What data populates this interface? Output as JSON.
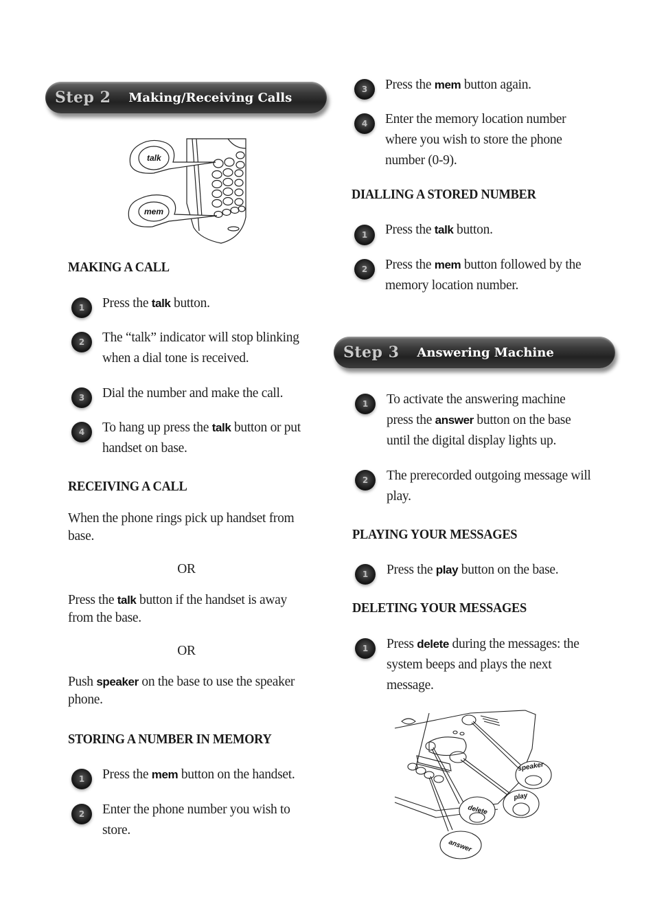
{
  "step2": {
    "banner": {
      "step_label": "Step 2",
      "title": "Making/Receiving Calls"
    },
    "illustration": {
      "callouts": [
        "talk",
        "mem"
      ]
    },
    "making_a_call": {
      "heading": "MAKING A CALL",
      "steps": [
        {
          "num": "1",
          "pre": "Press the ",
          "kw": "talk",
          "post": " button."
        },
        {
          "num": "2",
          "text": "The “talk” indicator will stop blinking when a dial tone is received."
        },
        {
          "num": "3",
          "text": "Dial the number and make the call."
        },
        {
          "num": "4",
          "pre": "To hang up press the ",
          "kw": "talk",
          "post": " button or put handset on base."
        }
      ]
    },
    "receiving_a_call": {
      "heading": "RECEIVING A CALL",
      "para1": "When the phone rings pick up handset from base.",
      "or1": "OR",
      "para2": {
        "pre": "Press the ",
        "kw": "talk",
        "post": " button if the handset is away from the base."
      },
      "or2": "OR",
      "para3": {
        "pre": "Push ",
        "kw": "speaker",
        "post": " on the base to use the speaker phone."
      }
    },
    "storing": {
      "heading": "STORING A NUMBER IN MEMORY",
      "steps": [
        {
          "num": "1",
          "pre": "Press the ",
          "kw": "mem",
          "post": " button on the handset."
        },
        {
          "num": "2",
          "text": "Enter the phone number you wish to store."
        },
        {
          "num": "3",
          "pre": "Press the ",
          "kw": "mem",
          "post": " button again."
        },
        {
          "num": "4",
          "text": "Enter the memory location number where you wish to store the phone number (0-9)."
        }
      ]
    },
    "dialling": {
      "heading": "DIALLING A STORED NUMBER",
      "steps": [
        {
          "num": "1",
          "pre": "Press the ",
          "kw": "talk",
          "post": " button."
        },
        {
          "num": "2",
          "pre": "Press the ",
          "kw": "mem",
          "post": " button followed by the memory location number."
        }
      ]
    }
  },
  "step3": {
    "banner": {
      "step_label": "Step 3",
      "title": "Answering Machine"
    },
    "activate": {
      "steps": [
        {
          "num": "1",
          "pre": "To activate the answering machine press the ",
          "kw": "answer",
          "post": " button on the base until the digital display lights up."
        },
        {
          "num": "2",
          "text": "The prerecorded outgoing message will play."
        }
      ]
    },
    "playing": {
      "heading": "PLAYING YOUR MESSAGES",
      "steps": [
        {
          "num": "1",
          "pre": "Press the ",
          "kw": "play",
          "post": " button on the base."
        }
      ]
    },
    "deleting": {
      "heading": "DELETING YOUR MESSAGES",
      "steps": [
        {
          "num": "1",
          "pre": "Press ",
          "kw": "delete",
          "post": " during the messages: the system beeps and plays the next message."
        }
      ]
    },
    "illustration": {
      "callouts": [
        "speaker",
        "play",
        "delete",
        "answer"
      ]
    }
  }
}
